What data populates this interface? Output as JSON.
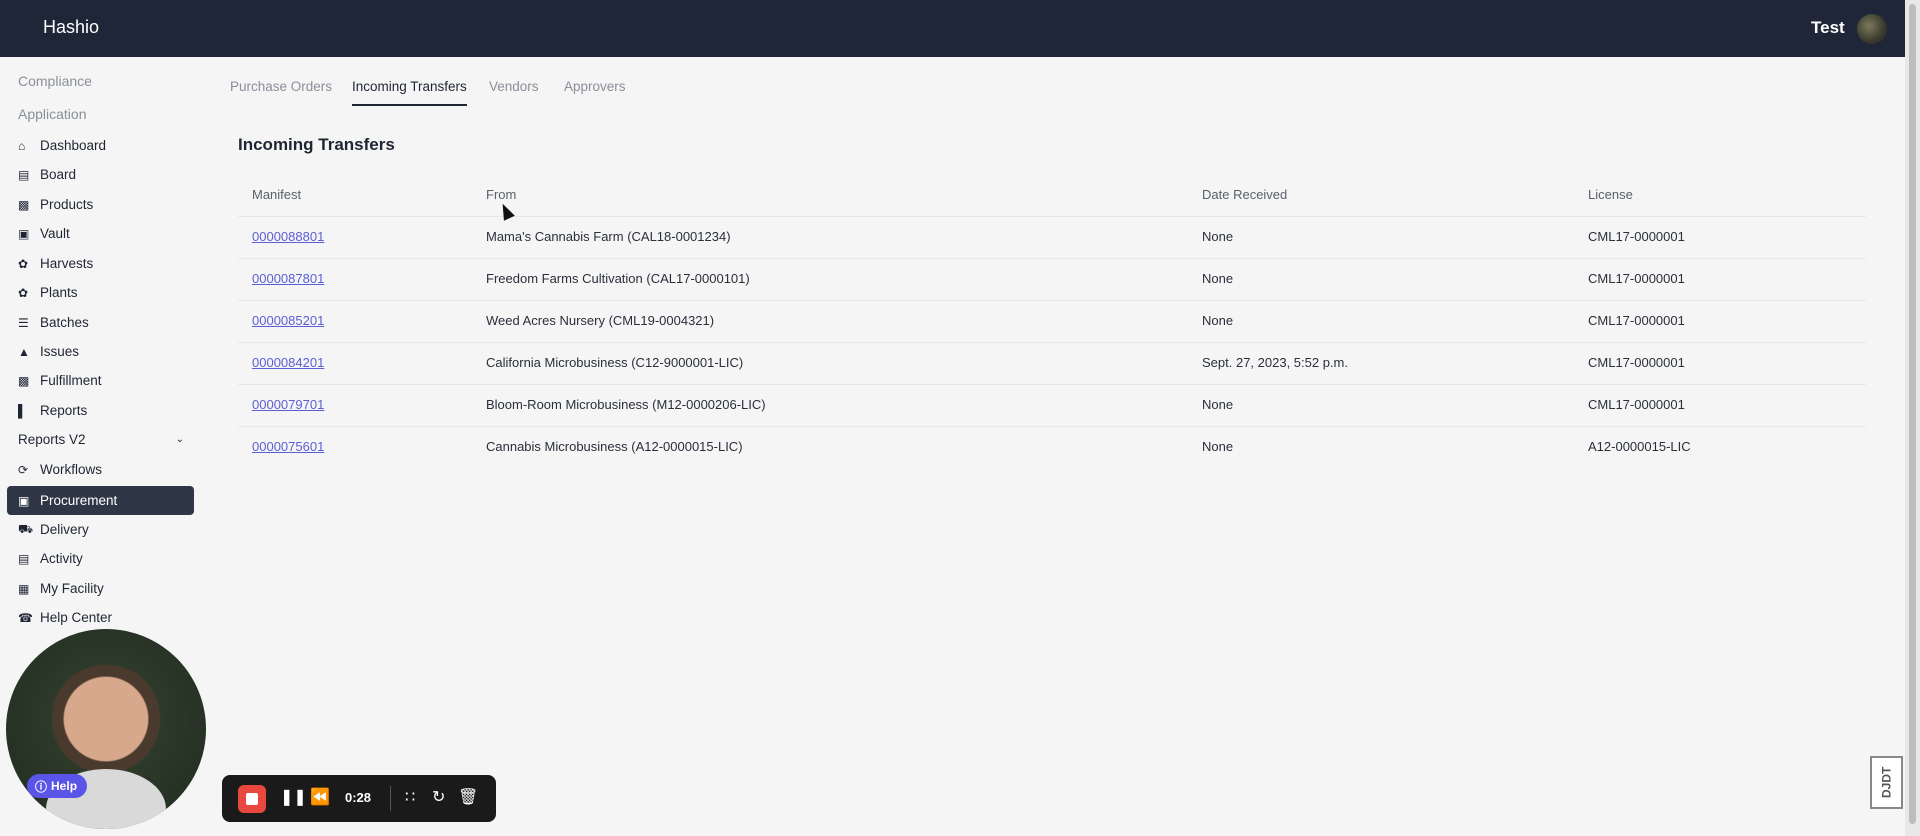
{
  "app": {
    "brand": "Hashio",
    "user_name": "Test"
  },
  "sidebar": {
    "sections": [
      "Compliance",
      "Application"
    ],
    "items": [
      {
        "label": "Dashboard",
        "icon": "home-icon"
      },
      {
        "label": "Board",
        "icon": "board-icon"
      },
      {
        "label": "Products",
        "icon": "products-icon"
      },
      {
        "label": "Vault",
        "icon": "vault-icon"
      },
      {
        "label": "Harvests",
        "icon": "harvests-icon"
      },
      {
        "label": "Plants",
        "icon": "plants-icon"
      },
      {
        "label": "Batches",
        "icon": "batches-icon"
      },
      {
        "label": "Issues",
        "icon": "warning-icon"
      },
      {
        "label": "Fulfillment",
        "icon": "fulfillment-icon"
      },
      {
        "label": "Reports",
        "icon": "reports-icon"
      },
      {
        "label": "Reports V2",
        "icon": ""
      },
      {
        "label": "Workflows",
        "icon": "workflows-icon"
      },
      {
        "label": "Procurement",
        "icon": "shopping-bag-icon"
      },
      {
        "label": "Delivery",
        "icon": "truck-icon"
      },
      {
        "label": "Activity",
        "icon": "activity-icon"
      },
      {
        "label": "My Facility",
        "icon": "facility-icon"
      },
      {
        "label": "Help Center",
        "icon": "headset-icon"
      }
    ],
    "active": "Procurement"
  },
  "tabs": [
    "Purchase Orders",
    "Incoming Transfers",
    "Vendors",
    "Approvers"
  ],
  "active_tab": "Incoming Transfers",
  "page_title": "Incoming Transfers",
  "table": {
    "headers": [
      "Manifest",
      "From",
      "Date Received",
      "License"
    ],
    "rows": [
      [
        "0000088801",
        "Mama's Cannabis Farm (CAL18-0001234)",
        "None",
        "CML17-0000001"
      ],
      [
        "0000087801",
        "Freedom Farms Cultivation (CAL17-0000101)",
        "None",
        "CML17-0000001"
      ],
      [
        "0000085201",
        "Weed Acres Nursery (CML19-0004321)",
        "None",
        "CML17-0000001"
      ],
      [
        "0000084201",
        "California Microbusiness (C12-9000001-LIC)",
        "Sept. 27, 2023, 5:52 p.m.",
        "CML17-0000001"
      ],
      [
        "0000079701",
        "Bloom-Room Microbusiness (M12-0000206-LIC)",
        "None",
        "CML17-0000001"
      ],
      [
        "0000075601",
        "Cannabis Microbusiness (A12-0000015-LIC)",
        "None",
        "A12-0000015-LIC"
      ]
    ]
  },
  "overlay": {
    "help_label": "Help",
    "recorder_time": "0:28",
    "corner_badge": "DJDT"
  }
}
